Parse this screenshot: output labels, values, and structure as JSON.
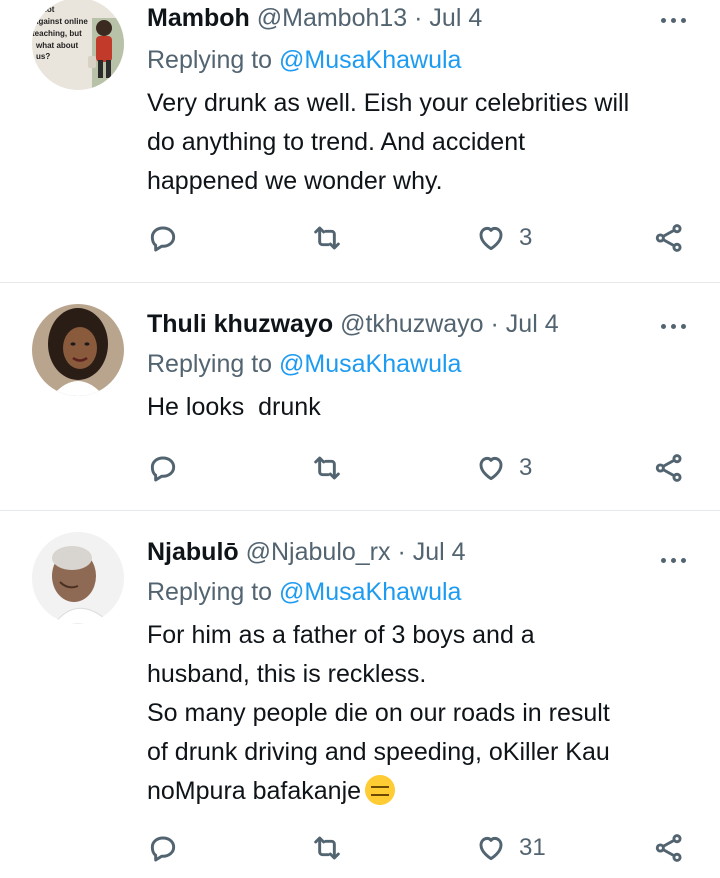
{
  "tweets": [
    {
      "name": "Mamboh",
      "handle": "@Mamboh13",
      "date": "· Jul 4",
      "reply_prefix": "Replying to",
      "reply_to": "@MusaKhawula",
      "lines": [
        "Very drunk as well. Eish your celebrities will",
        "do anything to trend. And accident",
        "happened we wonder why."
      ],
      "likes": "3",
      "avatar_text": [
        "not",
        "against online",
        "teaching, but",
        "what about",
        "us?"
      ]
    },
    {
      "name": "Thuli khuzwayo",
      "handle": "@tkhuzwayo",
      "date": "· Jul 4",
      "reply_prefix": "Replying to",
      "reply_to": "@MusaKhawula",
      "lines": [
        "He looks  drunk"
      ],
      "likes": "3"
    },
    {
      "name": "Njabulō",
      "handle": "@Njabulo_rx",
      "date": "· Jul 4",
      "reply_prefix": "Replying to",
      "reply_to": "@MusaKhawula",
      "lines": [
        "For him as a father of 3 boys and a",
        "husband, this is reckless.",
        "So many people die on our roads in result",
        "of drunk driving and speeding, oKiller Kau",
        "noMpura bafakanje"
      ],
      "emoji": "expressionless-face-emoji",
      "likes": "31"
    }
  ],
  "icons": {
    "reply": "reply-icon",
    "retweet": "retweet-icon",
    "like": "heart-icon",
    "share": "share-icon",
    "more": "more-icon"
  },
  "colors": {
    "link": "#1d9bf0",
    "muted": "#536471",
    "text": "#0f1419",
    "divider": "#e6e9eb"
  }
}
